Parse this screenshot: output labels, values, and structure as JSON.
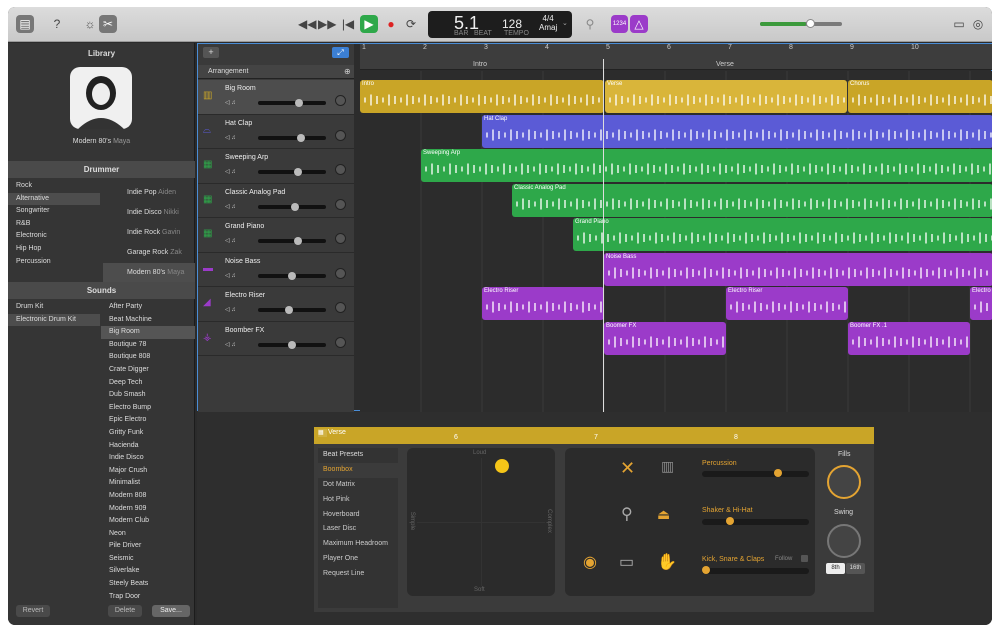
{
  "lcd": {
    "bar": "5.1",
    "bar_label": "BAR",
    "beat_label": "BEAT",
    "tempo": "128",
    "tempo_label": "TEMPO",
    "signature": "4/4",
    "key": "Amaj"
  },
  "toolbar": {
    "counter_label": "1234"
  },
  "library": {
    "title": "Library",
    "drummer_name": "Modern 80's",
    "drummer_person": "Maya",
    "drummer_header": "Drummer",
    "genres": [
      "Rock",
      "Alternative",
      "Songwriter",
      "R&B",
      "Electronic",
      "Hip Hop",
      "Percussion"
    ],
    "drummers": [
      {
        "style": "Indie Pop",
        "name": "Aiden"
      },
      {
        "style": "Indie Disco",
        "name": "Nikki"
      },
      {
        "style": "Indie Rock",
        "name": "Gavin"
      },
      {
        "style": "Garage Rock",
        "name": "Zak"
      },
      {
        "style": "Modern 80's",
        "name": "Maya"
      }
    ],
    "sounds_header": "Sounds",
    "sound_categories": [
      "Drum Kit",
      "Electronic Drum Kit"
    ],
    "sounds": [
      "After Party",
      "Beat Machine",
      "Big Room",
      "Boutique 78",
      "Boutique 808",
      "Crate Digger",
      "Deep Tech",
      "Dub Smash",
      "Electro Bump",
      "Epic Electro",
      "Gritty Funk",
      "Hacienda",
      "Indie Disco",
      "Major Crush",
      "Minimalist",
      "Modern 808",
      "Modern 909",
      "Modern Club",
      "Neon",
      "Pile Driver",
      "Seismic",
      "Silverlake",
      "Steely Beats",
      "Trap Door"
    ],
    "revert": "Revert",
    "delete": "Delete",
    "save": "Save..."
  },
  "arrangement": {
    "label": "Arrangement",
    "sections": [
      "Intro",
      "Verse"
    ]
  },
  "ruler": [
    "1",
    "2",
    "3",
    "4",
    "5",
    "6",
    "7",
    "8",
    "9",
    "10"
  ],
  "tracks": [
    {
      "name": "Big Room",
      "color": "#c9a527",
      "fader": 0.62
    },
    {
      "name": "Hat Clap",
      "color": "#5b5bd6",
      "fader": 0.65
    },
    {
      "name": "Sweeping Arp",
      "color": "#2ea84a",
      "fader": 0.6
    },
    {
      "name": "Classic Analog Pad",
      "color": "#2ea84a",
      "fader": 0.55
    },
    {
      "name": "Grand Piano",
      "color": "#2ea84a",
      "fader": 0.6
    },
    {
      "name": "Noise Bass",
      "color": "#9b3bc9",
      "fader": 0.5
    },
    {
      "name": "Electro Riser",
      "color": "#9b3bc9",
      "fader": 0.45
    },
    {
      "name": "Boomber FX",
      "color": "#9b3bc9",
      "fader": 0.5
    }
  ],
  "regions": {
    "intro": "Intro",
    "verse": "Verse",
    "chorus": "Chorus",
    "hat_clap": "Hat Clap",
    "sweeping_arp": "Sweeping Arp",
    "sweeping_arp_end": "Sw",
    "classic_pad": "Classic Analog Pad",
    "grand_piano": "Grand Piano",
    "noise_bass": "Noise Bass",
    "electro_riser": "Electro Riser",
    "electro_riser_end": "Electro",
    "boomer_fx": "Boomer FX",
    "boomer_fx1": "Boomer FX .1"
  },
  "editor": {
    "region": "Verse",
    "ruler": [
      "6",
      "7",
      "8"
    ],
    "presets_title": "Beat Presets",
    "presets": [
      "Boombox",
      "Dot Matrix",
      "Hot Pink",
      "Hoverboard",
      "Laser Disc",
      "Maximum Headroom",
      "Player One",
      "Request Line"
    ],
    "xy": {
      "loud": "Loud",
      "soft": "Soft",
      "simple": "Simple",
      "complex": "Complex"
    },
    "percussion": "Percussion",
    "shaker": "Shaker & Hi-Hat",
    "kick": "Kick, Snare & Claps",
    "follow": "Follow",
    "fills": "Fills",
    "swing": "Swing",
    "eighth": "8th",
    "sixteenth": "16th"
  }
}
